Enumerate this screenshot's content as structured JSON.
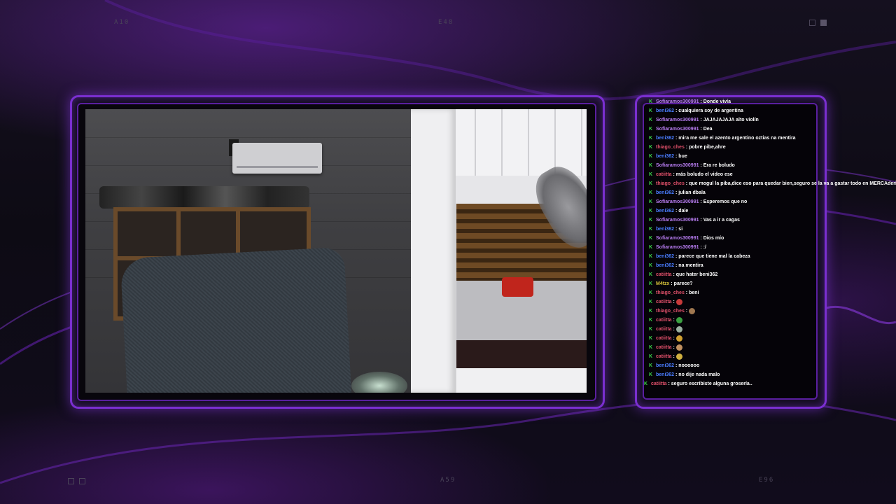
{
  "corner_labels": {
    "top_left": "A10",
    "top_center": "E48",
    "bottom_center": "A59",
    "bottom_right": "E96"
  },
  "theme": {
    "accent": "#7a2fd0",
    "badge": "#3cd64a"
  },
  "chat": {
    "messages": [
      {
        "user": "Sofiaramos300991",
        "color": "purple",
        "text": " : Donde vivía"
      },
      {
        "user": "beni362",
        "color": "blue",
        "text": " : cualquiera soy de argentina"
      },
      {
        "user": "Sofiaramos300991",
        "color": "purple",
        "text": " : JAJAJAJAJA alto violín"
      },
      {
        "user": "Sofiaramos300991",
        "color": "purple",
        "text": " : Dea"
      },
      {
        "user": "beni362",
        "color": "blue",
        "text": " : mira me sale el azento argentino oztias na mentira"
      },
      {
        "user": "thiago_ches",
        "color": "pink",
        "text": " : pobre pibe,ahre"
      },
      {
        "user": "beni362",
        "color": "blue",
        "text": " : bue"
      },
      {
        "user": "Sofiaramos300991",
        "color": "purple",
        "text": " : Era re boludo"
      },
      {
        "user": "catiitta",
        "color": "pink",
        "text": " : más boludo el video ese"
      },
      {
        "user": "thiago_ches",
        "color": "pink",
        "text": " : que mogul la piba,dice eso para quedar bien,seguro se la va a gastar todo en MERCAderia"
      },
      {
        "user": "beni362",
        "color": "blue",
        "text": " : julian dbala"
      },
      {
        "user": "Sofiaramos300991",
        "color": "purple",
        "text": " : Esperemos que no"
      },
      {
        "user": "beni362",
        "color": "blue",
        "text": " : dale"
      },
      {
        "user": "Sofiaramos300991",
        "color": "purple",
        "text": " : Vas a ir a cagas"
      },
      {
        "user": "beni362",
        "color": "blue",
        "text": " : si"
      },
      {
        "user": "Sofiaramos300991",
        "color": "purple",
        "text": " : Dios mío"
      },
      {
        "user": "Sofiaramos300991",
        "color": "purple",
        "text": " : :/"
      },
      {
        "user": "beni362",
        "color": "blue",
        "text": " : parece que tiene mal la cabeza"
      },
      {
        "user": "beni362",
        "color": "blue",
        "text": " : na mentira"
      },
      {
        "user": "catiitta",
        "color": "pink",
        "text": " : que hater beni362"
      },
      {
        "user": "M4tzx",
        "color": "yellow",
        "text": " : parece?"
      },
      {
        "user": "thiago_ches",
        "color": "pink",
        "text": " : beni"
      },
      {
        "user": "catiitta",
        "color": "pink",
        "text": " : ",
        "emote": "#c83a3a"
      },
      {
        "user": "thiago_ches",
        "color": "pink",
        "text": " : ",
        "emote": "#a07850"
      },
      {
        "user": "catiitta",
        "color": "pink",
        "text": " : ",
        "emote": "#3aa040"
      },
      {
        "user": "catiitta",
        "color": "pink",
        "text": " : ",
        "emote": "#9ab0a0"
      },
      {
        "user": "catiitta",
        "color": "pink",
        "text": " : ",
        "emote": "#d0a030"
      },
      {
        "user": "catiitta",
        "color": "pink",
        "text": " : ",
        "emote": "#c09060"
      },
      {
        "user": "catiitta",
        "color": "pink",
        "text": " : ",
        "emote": "#d0b040"
      },
      {
        "user": "beni362",
        "color": "blue",
        "text": " : noooooo"
      },
      {
        "user": "beni362",
        "color": "blue",
        "text": " : no dije nada malo"
      },
      {
        "user": "catiitta",
        "color": "pink",
        "text": " : seguro escribiste alguna grosería.."
      }
    ]
  }
}
